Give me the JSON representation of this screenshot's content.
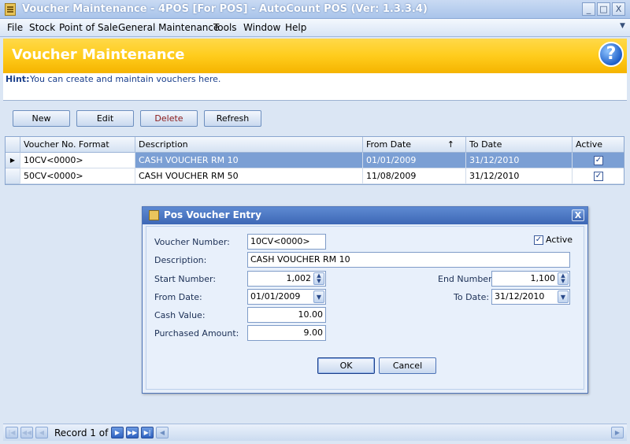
{
  "window": {
    "title": "Voucher Maintenance - 4POS [For POS] - AutoCount POS (Ver: 1.3.3.4)",
    "minimize": "_",
    "maximize": "□",
    "close": "X"
  },
  "menu": {
    "items": [
      "File",
      "Stock",
      "Point of Sale",
      "General Maintenance",
      "Tools",
      "Window",
      "Help"
    ]
  },
  "header": {
    "title": "Voucher Maintenance",
    "help_glyph": "?"
  },
  "hint": {
    "label": "Hint:",
    "text": "You can create and maintain vouchers here."
  },
  "toolbar": {
    "new_label": "New",
    "edit_label": "Edit",
    "delete_label": "Delete",
    "refresh_label": "Refresh"
  },
  "grid": {
    "columns": [
      "Voucher No. Format",
      "Description",
      "From Date",
      "To Date",
      "Active"
    ],
    "sort_indicator": "↑",
    "rows": [
      {
        "format": "10CV<0000>",
        "description": "CASH VOUCHER RM 10",
        "from": "01/01/2009",
        "to": "31/12/2010",
        "active": "✓"
      },
      {
        "format": "50CV<0000>",
        "description": "CASH VOUCHER RM 50",
        "from": "11/08/2009",
        "to": "31/12/2010",
        "active": "✓"
      }
    ],
    "row_indicator": "▶"
  },
  "dialog": {
    "title": "Pos Voucher Entry",
    "close": "X",
    "voucher_number_label": "Voucher Number:",
    "voucher_number": "10CV<0000>",
    "active_label": "Active",
    "active_check": "✓",
    "description_label": "Description:",
    "description": "CASH VOUCHER RM 10",
    "start_number_label": "Start Number:",
    "start_number": "1,002",
    "end_number_label": "End Number:",
    "end_number": "1,100",
    "from_date_label": "From Date:",
    "from_date": "01/01/2009",
    "to_date_label": "To Date:",
    "to_date": "31/12/2010",
    "cash_value_label": "Cash Value:",
    "cash_value": "10.00",
    "purchased_amount_label": "Purchased Amount:",
    "purchased_amount": "9.00",
    "ok_label": "OK",
    "cancel_label": "Cancel"
  },
  "navigator": {
    "record_text": "Record 1 of 2"
  },
  "colors": {
    "header_orange": "#ffcc1c",
    "selection_blue": "#7b9fd4",
    "dialog_title_blue": "#3d67b5"
  }
}
